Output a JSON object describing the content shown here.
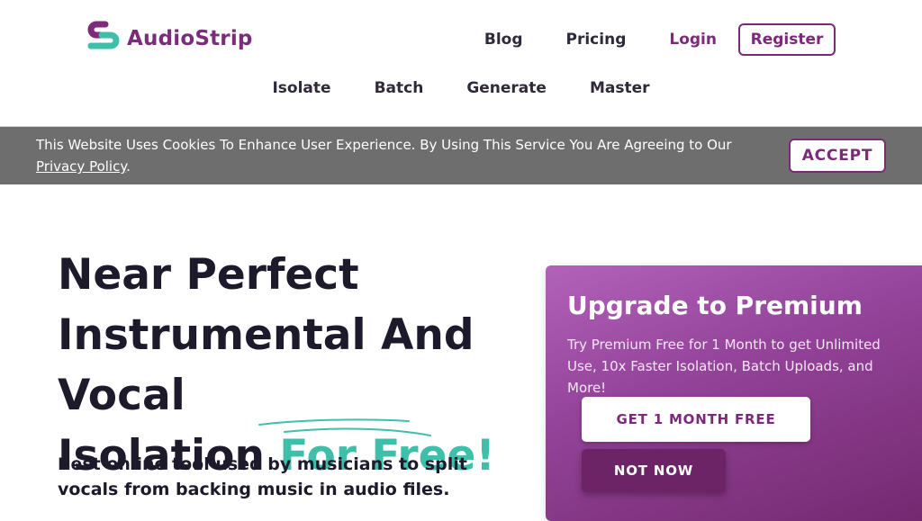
{
  "brand": {
    "name": "AudioStrip",
    "logo_icon": "audiostrip-logo-icon",
    "colors": {
      "primary": "#7a2a78",
      "accent": "#3fbfa9"
    }
  },
  "nav_top": {
    "blog": "Blog",
    "pricing": "Pricing",
    "login": "Login",
    "register": "Register"
  },
  "nav_sub": {
    "isolate": "Isolate",
    "batch": "Batch",
    "generate": "Generate",
    "master": "Master"
  },
  "cookie": {
    "text": "This Website Uses Cookies To Enhance User Experience. By Using This Service You Are Agreeing to Our ",
    "link": "Privacy Policy",
    "end": ".",
    "accept": "ACCEPT"
  },
  "hero": {
    "title_line1": "Near Perfect",
    "title_line2": "Instrumental And Vocal",
    "title_line3": "Isolation ",
    "title_highlight": "For Free!",
    "subtitle": "Best online tool used by musicians to split vocals from backing music in audio files."
  },
  "premium": {
    "title": "Upgrade to Premium",
    "text": "Try Premium Free for 1 Month to get Unlimited Use, 10x Faster Isolation, Batch Uploads, and More!",
    "cta": "GET 1 MONTH FREE",
    "dismiss": "NOT NOW"
  }
}
